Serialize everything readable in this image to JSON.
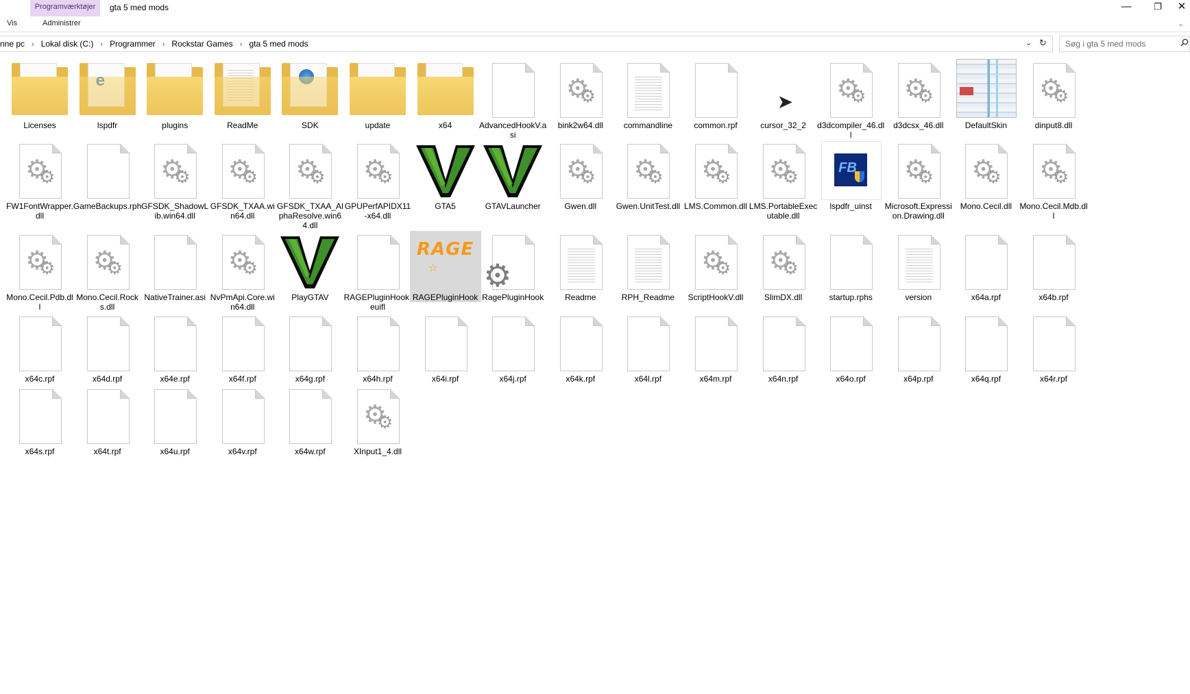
{
  "window": {
    "context_tab": "Programværktøjer",
    "title": "gta 5 med mods",
    "ribbon_tabs": [
      "Vis",
      "Administrer"
    ],
    "controls": {
      "minimize": "—",
      "maximize": "❐",
      "close": "✕"
    },
    "ribbon_expand": "⌄"
  },
  "address": {
    "crumbs": [
      "nne pc",
      "Lokal disk (C:)",
      "Programmer",
      "Rockstar Games",
      "gta 5 med mods"
    ],
    "separator": "›",
    "dropdown": "⌄",
    "refresh": "↻"
  },
  "search": {
    "placeholder": "Søg i gta 5 med mods",
    "icon": "search-icon"
  },
  "colors": {
    "folder": "#e6b94a",
    "selection": "#d9d9d9",
    "context_tab": "#e6d4f1"
  },
  "files": [
    {
      "name": "Licenses",
      "icon": "folder"
    },
    {
      "name": "lspdfr",
      "icon": "folder-edge"
    },
    {
      "name": "plugins",
      "icon": "folder"
    },
    {
      "name": "ReadMe",
      "icon": "folder-docs"
    },
    {
      "name": "SDK",
      "icon": "folder-globe"
    },
    {
      "name": "update",
      "icon": "folder"
    },
    {
      "name": "x64",
      "icon": "folder"
    },
    {
      "name": "AdvancedHookV.asi",
      "icon": "blank"
    },
    {
      "name": "bink2w64.dll",
      "icon": "dll"
    },
    {
      "name": "commandline",
      "icon": "text"
    },
    {
      "name": "common.rpf",
      "icon": "blank"
    },
    {
      "name": "cursor_32_2",
      "icon": "cursor"
    },
    {
      "name": "d3dcompiler_46.dll",
      "icon": "dll"
    },
    {
      "name": "d3dcsx_46.dll",
      "icon": "dll"
    },
    {
      "name": "DefaultSkin",
      "icon": "skin"
    },
    {
      "name": "dinput8.dll",
      "icon": "dll"
    },
    {
      "name": "FW1FontWrapper.dll",
      "icon": "dll"
    },
    {
      "name": "GameBackups.rph",
      "icon": "blank"
    },
    {
      "name": "GFSDK_ShadowLib.win64.dll",
      "icon": "dll"
    },
    {
      "name": "GFSDK_TXAA.win64.dll",
      "icon": "dll"
    },
    {
      "name": "GFSDK_TXAA_AlphaResolve.win64.dll",
      "icon": "dll"
    },
    {
      "name": "GPUPerfAPIDX11-x64.dll",
      "icon": "dll"
    },
    {
      "name": "GTA5",
      "icon": "gtav"
    },
    {
      "name": "GTAVLauncher",
      "icon": "gtav"
    },
    {
      "name": "Gwen.dll",
      "icon": "dll"
    },
    {
      "name": "Gwen.UnitTest.dll",
      "icon": "dll"
    },
    {
      "name": "LMS.Common.dll",
      "icon": "dll"
    },
    {
      "name": "LMS.PortableExecutable.dll",
      "icon": "dll"
    },
    {
      "name": "lspdfr_uinst",
      "icon": "fb"
    },
    {
      "name": "Microsoft.Expression.Drawing.dll",
      "icon": "dll"
    },
    {
      "name": "Mono.Cecil.dll",
      "icon": "dll"
    },
    {
      "name": "Mono.Cecil.Mdb.dll",
      "icon": "dll"
    },
    {
      "name": "Mono.Cecil.Pdb.dll",
      "icon": "dll"
    },
    {
      "name": "Mono.Cecil.Rocks.dll",
      "icon": "dll"
    },
    {
      "name": "NativeTrainer.asi",
      "icon": "blank"
    },
    {
      "name": "NvPmApi.Core.win64.dll",
      "icon": "dll"
    },
    {
      "name": "PlayGTAV",
      "icon": "gtav"
    },
    {
      "name": "RAGEPluginHook.euifl",
      "icon": "blank"
    },
    {
      "name": "RAGEPluginHook",
      "icon": "rage",
      "selected": true
    },
    {
      "name": "RagePluginHook",
      "icon": "rph"
    },
    {
      "name": "Readme",
      "icon": "text"
    },
    {
      "name": "RPH_Readme",
      "icon": "text"
    },
    {
      "name": "ScriptHookV.dll",
      "icon": "dll"
    },
    {
      "name": "SlimDX.dll",
      "icon": "dll"
    },
    {
      "name": "startup.rphs",
      "icon": "blank"
    },
    {
      "name": "version",
      "icon": "text"
    },
    {
      "name": "x64a.rpf",
      "icon": "blank"
    },
    {
      "name": "x64b.rpf",
      "icon": "blank"
    },
    {
      "name": "x64c.rpf",
      "icon": "blank"
    },
    {
      "name": "x64d.rpf",
      "icon": "blank"
    },
    {
      "name": "x64e.rpf",
      "icon": "blank"
    },
    {
      "name": "x64f.rpf",
      "icon": "blank"
    },
    {
      "name": "x64g.rpf",
      "icon": "blank"
    },
    {
      "name": "x64h.rpf",
      "icon": "blank"
    },
    {
      "name": "x64i.rpf",
      "icon": "blank"
    },
    {
      "name": "x64j.rpf",
      "icon": "blank"
    },
    {
      "name": "x64k.rpf",
      "icon": "blank"
    },
    {
      "name": "x64l.rpf",
      "icon": "blank"
    },
    {
      "name": "x64m.rpf",
      "icon": "blank"
    },
    {
      "name": "x64n.rpf",
      "icon": "blank"
    },
    {
      "name": "x64o.rpf",
      "icon": "blank"
    },
    {
      "name": "x64p.rpf",
      "icon": "blank"
    },
    {
      "name": "x64q.rpf",
      "icon": "blank"
    },
    {
      "name": "x64r.rpf",
      "icon": "blank"
    },
    {
      "name": "x64s.rpf",
      "icon": "blank"
    },
    {
      "name": "x64t.rpf",
      "icon": "blank"
    },
    {
      "name": "x64u.rpf",
      "icon": "blank"
    },
    {
      "name": "x64v.rpf",
      "icon": "blank"
    },
    {
      "name": "x64w.rpf",
      "icon": "blank"
    },
    {
      "name": "XInput1_4.dll",
      "icon": "dll"
    }
  ]
}
